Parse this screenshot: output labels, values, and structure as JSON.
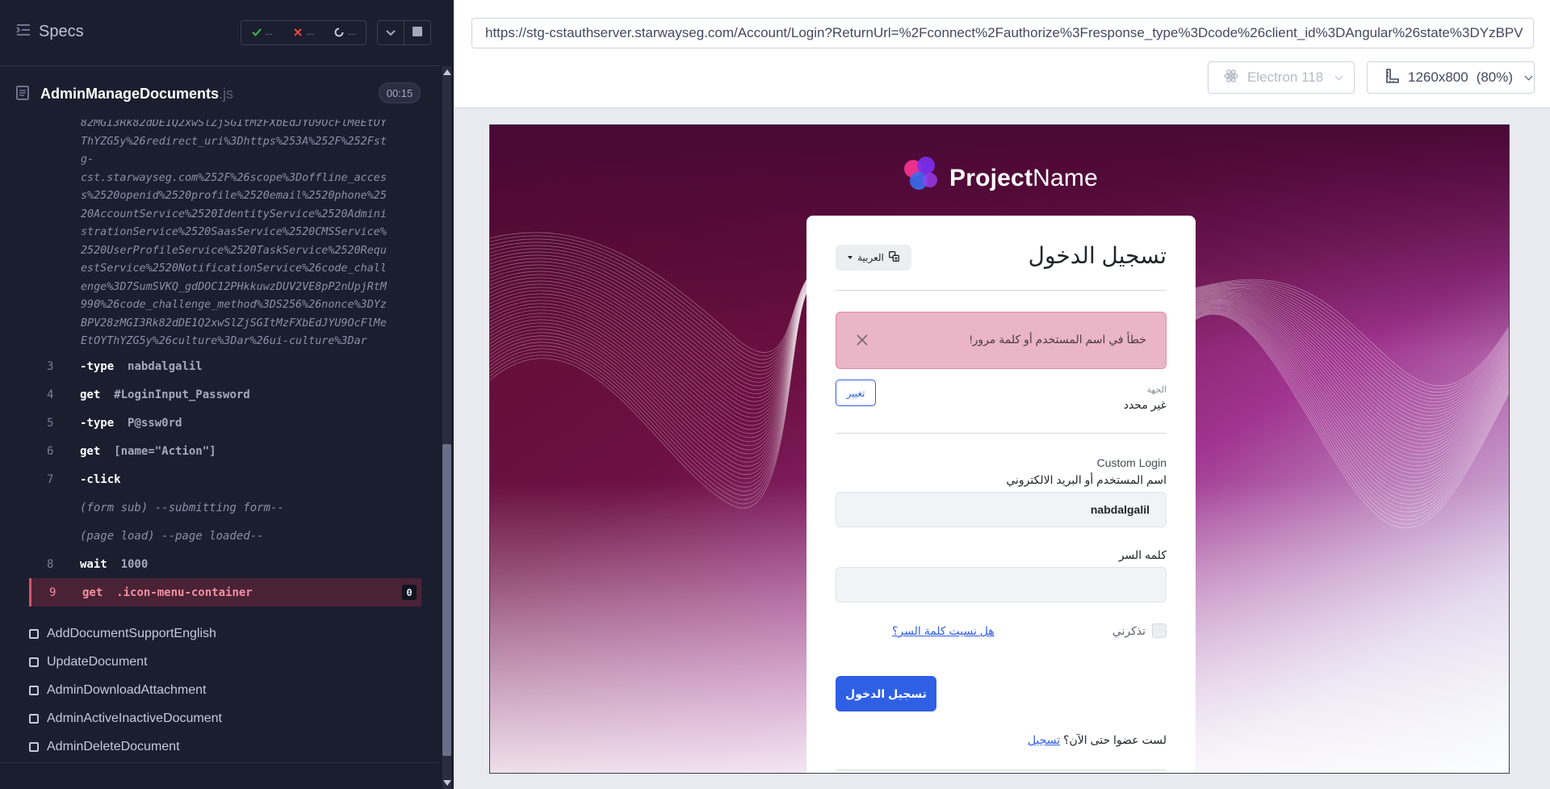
{
  "reporter": {
    "specs_label": "Specs",
    "stats": {
      "passed": "--",
      "failed": "--",
      "pending": "--"
    },
    "file": {
      "name": "AdminManageDocuments",
      "ext": ".js",
      "duration": "00:15"
    },
    "url_lines": [
      "82MGI3Rk82dDE1Q2xwSlZjSGItMzFXbEdJYU9OcFlMeEtOY",
      "ThYZG5y%26redirect_uri%3Dhttps%253A%252F%252Fst",
      "g-",
      "cst.starwayseg.com%252F%26scope%3Doffline_acces",
      "s%2520openid%2520profile%2520email%2520phone%25",
      "20AccountService%2520IdentityService%2520Admini",
      "strationService%2520SaasService%2520CMSService%",
      "2520UserProfileService%2520TaskService%2520Requ",
      "estService%2520NotificationService%26code_chall",
      "enge%3D7SumSVKQ_gdDOC12PHkkuwzDUV2VE8pP2nUpjRtM",
      "990%26code_challenge_method%3DS256%26nonce%3DYz",
      "BPV28zMGI3Rk82dDE1Q2xwSlZjSGItMzFXbEdJYU9OcFlMe",
      "EtOYThYZG5y%26culture%3Dar%26ui-culture%3Dar"
    ],
    "commands": [
      {
        "num": "3",
        "name": "-type",
        "arg": "nabdalgalil"
      },
      {
        "num": "4",
        "name": "get",
        "arg": "#LoginInput_Password"
      },
      {
        "num": "5",
        "name": "-type",
        "arg": "P@ssw0rd"
      },
      {
        "num": "6",
        "name": "get",
        "arg": "[name=\"Action\"]"
      },
      {
        "num": "7",
        "name": "-click",
        "arg": ""
      },
      {
        "num": "",
        "name": "",
        "arg": "(form sub)  --submitting form--"
      },
      {
        "num": "",
        "name": "",
        "arg": "(page load)  --page loaded--"
      },
      {
        "num": "8",
        "name": "wait",
        "arg": "1000"
      },
      {
        "num": "9",
        "name": "get",
        "arg": ".icon-menu-container",
        "badge": "0"
      }
    ],
    "tests": [
      "AddDocumentSupportEnglish",
      "UpdateDocument",
      "AdminDownloadAttachment",
      "AdminActiveInactiveDocument",
      "AdminDeleteDocument"
    ]
  },
  "aut": {
    "url": "https://stg-cstauthserver.starwayseg.com/Account/Login?ReturnUrl=%2Fconnect%2Fauthorize%3Fresponse_type%3Dcode%26client_id%3DAngular%26state%3DYzBPV",
    "browser": "Electron 118",
    "viewport": "1260x800",
    "scale": "(80%)"
  },
  "page": {
    "brand_bold": "Project",
    "brand_rest": "Name",
    "title": "تسجيل الدخول",
    "language": "العربية",
    "alert": "خطأ في اسم المستخدم أو كلمة مرور!",
    "tenant_label": "الجهة",
    "tenant_value": "غير محدد",
    "change_btn": "تغيير",
    "custom_login": "Custom Login",
    "username_label": "اسم المستخدم أو البريد الالكتروني",
    "username_value": "nabdalgalil",
    "password_label": "كلمه السر",
    "remember_label": "تذكرني",
    "forgot_label": "هل نسيت كلمة السر؟",
    "login_btn": "تسجيل الدخول",
    "register_prompt": "لست عضوا حتى الآن؟",
    "register_link": "تسجيل"
  },
  "colors": {
    "reporter_bg": "#1b1e2e",
    "active_command": "#4a2236",
    "primary": "#2f5fe4",
    "alert_bg": "#eab5c6",
    "passed": "#3fb950",
    "failed": "#e5484d"
  },
  "icons": [
    "specs-icon",
    "check-icon",
    "cross-icon",
    "spinner-icon",
    "chevron-down-icon",
    "stop-icon",
    "file-icon",
    "electron-icon",
    "viewport-icon",
    "brand-logo-icon",
    "translate-icon",
    "close-icon"
  ]
}
